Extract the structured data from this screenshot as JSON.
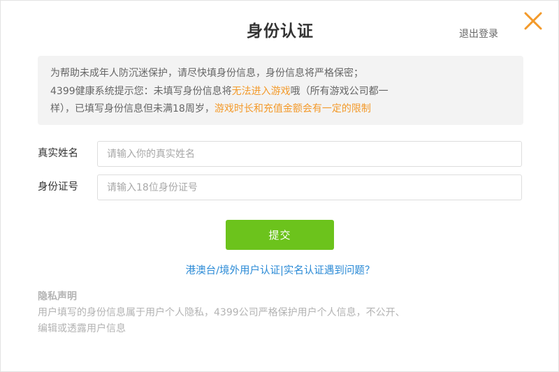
{
  "dialog": {
    "title": "身份认证",
    "logout_label": "退出登录",
    "close_icon": "close-icon",
    "accent_color": "#f39a2b"
  },
  "notice": {
    "line1": "为帮助未成年人防沉迷保护，请尽快填身份信息，身份信息将严格保密；",
    "line2_prefix": "4399健康系统提示您：未填写身份信息将",
    "line2_highlight": "无法进入游戏",
    "line2_suffix": "哦（所有游戏公司都一",
    "line3_prefix": "样），已填写身份信息但未满18周岁，",
    "line3_highlight": "游戏时长和充值金额会有一定的限制"
  },
  "form": {
    "name_label": "真实姓名",
    "name_value": "",
    "name_placeholder": "请输入你的真实姓名",
    "id_label": "身份证号",
    "id_value": "",
    "id_placeholder": "请输入18位身份证号",
    "submit_label": "提交",
    "submit_color": "#6cc31c"
  },
  "links": {
    "overseas_label": "港澳台/境外用户认证",
    "separator": "|",
    "help_label": "实名认证遇到问题？",
    "link_color": "#2a8ad6"
  },
  "privacy": {
    "title": "隐私声明",
    "text_line1": "用户填写的身份信息属于用户个人隐私，4399公司严格保护用户个人信息，不公开、",
    "text_line2": "编辑或透露用户信息"
  }
}
